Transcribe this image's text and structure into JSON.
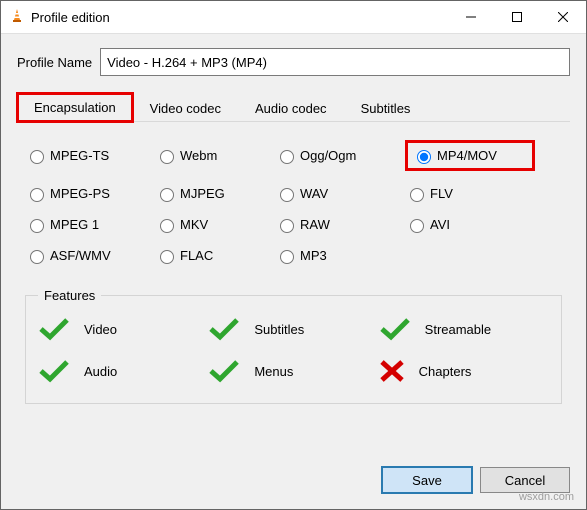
{
  "window": {
    "title": "Profile edition"
  },
  "profile": {
    "label": "Profile Name",
    "value": "Video - H.264 + MP3 (MP4)"
  },
  "tabs": {
    "encapsulation": "Encapsulation",
    "video_codec": "Video codec",
    "audio_codec": "Audio codec",
    "subtitles": "Subtitles",
    "active": "encapsulation"
  },
  "radios": {
    "mpeg_ts": "MPEG-TS",
    "webm": "Webm",
    "ogg": "Ogg/Ogm",
    "mp4": "MP4/MOV",
    "mpeg_ps": "MPEG-PS",
    "mjpeg": "MJPEG",
    "wav": "WAV",
    "flv": "FLV",
    "mpeg1": "MPEG 1",
    "mkv": "MKV",
    "raw": "RAW",
    "avi": "AVI",
    "asf": "ASF/WMV",
    "flac": "FLAC",
    "mp3": "MP3",
    "selected": "mp4"
  },
  "features": {
    "legend": "Features",
    "video": "Video",
    "subtitles": "Subtitles",
    "streamable": "Streamable",
    "audio": "Audio",
    "menus": "Menus",
    "chapters": "Chapters"
  },
  "buttons": {
    "save": "Save",
    "cancel": "Cancel"
  },
  "watermark": "wsxdn.com"
}
